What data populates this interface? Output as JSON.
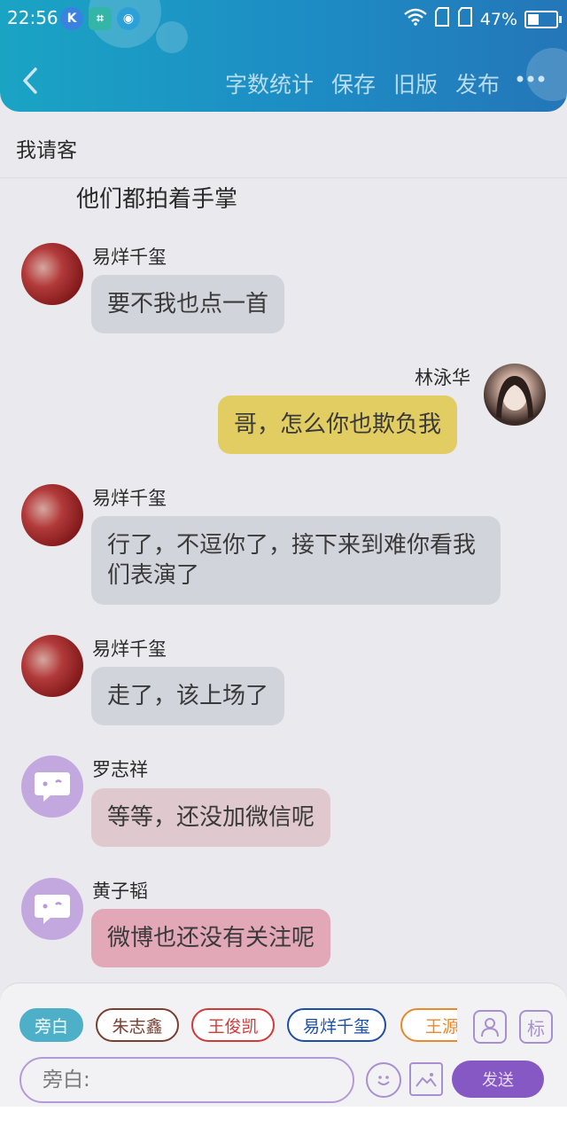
{
  "status": {
    "time": "22:56",
    "battery": "47%",
    "battery_level": 0.47
  },
  "nav": {
    "actions": [
      "字数统计",
      "保存",
      "旧版",
      "发布"
    ]
  },
  "chat_title": "我请客",
  "narration": "他们都拍着手掌",
  "messages": [
    {
      "sender": "易烊千玺",
      "text": "要不我也点一首"
    },
    {
      "sender": "林泳华",
      "text": "哥，怎么你也欺负我"
    },
    {
      "sender": "易烊千玺",
      "text": "行了，不逗你了，接下来到难你看我们表演了"
    },
    {
      "sender": "易烊千玺",
      "text": "走了，该上场了"
    },
    {
      "sender": "罗志祥",
      "text": "等等，还没加微信呢"
    },
    {
      "sender": "黄子韬",
      "text": "微博也还没有关注呢"
    }
  ],
  "roles": [
    {
      "label": "旁白",
      "color": "#4db0c8"
    },
    {
      "label": "朱志鑫",
      "color": "#7a3f30"
    },
    {
      "label": "王俊凯",
      "color": "#d23a3a"
    },
    {
      "label": "易烊千玺",
      "color": "#1d4fa8"
    },
    {
      "label": "王源",
      "color": "#e8892b"
    }
  ],
  "tools": {
    "tag_label": "标"
  },
  "input": {
    "placeholder": "旁白:"
  },
  "send_label": "发送"
}
